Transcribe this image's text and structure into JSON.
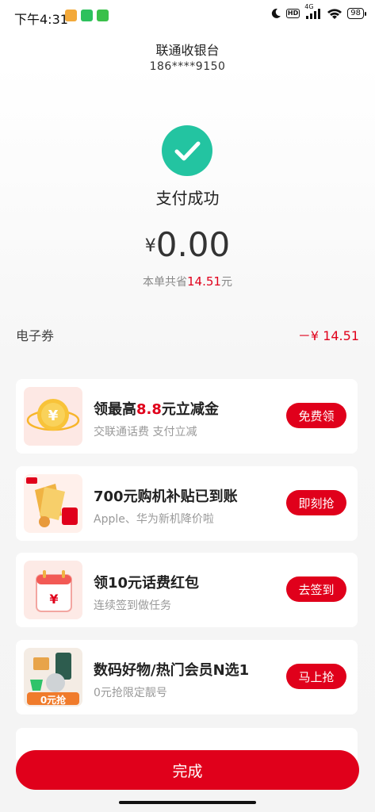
{
  "status_bar": {
    "time": "下午4:31",
    "network": "4G",
    "battery": "98"
  },
  "header": {
    "title": "联通收银台",
    "phone": "186****9150"
  },
  "result": {
    "status_text": "支付成功",
    "currency_symbol": "¥",
    "amount": "0.00",
    "saved_prefix": "本单共省",
    "saved_amount": "14.51",
    "saved_suffix": "元"
  },
  "coupon": {
    "label": "电子券",
    "amount": "－¥ 14.51"
  },
  "cards": [
    {
      "title_pre": "领最高",
      "title_hl": "8.8",
      "title_post": "元立减金",
      "subtitle": "交联通话费 支付立减",
      "button": "免费领"
    },
    {
      "title": "700元购机补贴已到账",
      "subtitle": "Apple、华为新机降价啦",
      "button": "即刻抢"
    },
    {
      "title": "领10元话费红包",
      "subtitle": "连续签到做任务",
      "button": "去签到"
    },
    {
      "title": "数码好物/热门会员N选1",
      "subtitle": "0元抢限定靓号",
      "button": "马上抢",
      "badge": "0元抢"
    }
  ],
  "footer": {
    "done_label": "完成"
  },
  "colors": {
    "accent": "#e0001b",
    "success": "#23c4a1"
  }
}
